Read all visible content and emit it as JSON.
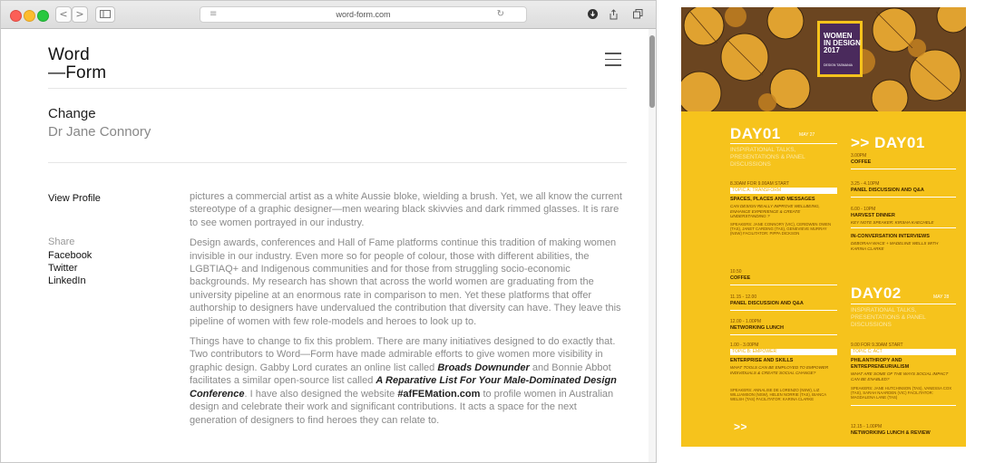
{
  "browser": {
    "reader_icon": "reader-icon",
    "url": "word-form.com",
    "reload_icon": "reload-icon",
    "back": "<",
    "forward": ">"
  },
  "site": {
    "logo_line1": "Word",
    "logo_line2": "—Form",
    "article_title": "Change",
    "article_author": "Dr Jane Connory",
    "view_profile": "View Profile",
    "share_label": "Share",
    "share_links": [
      "Facebook",
      "Twitter",
      "LinkedIn"
    ]
  },
  "article": {
    "p1": "pictures a commercial artist as a white Aussie bloke, wielding a brush. Yet, we all know the current stereotype of a graphic designer—men wearing black skivvies and dark rimmed glasses. It is rare to see women portrayed in our industry.",
    "p2": "Design awards, conferences and Hall of Fame platforms continue this tradition of making women invisible in our industry. Even more so for people of colour, those with different abilities, the LGBTIAQ+ and Indigenous communities and for those from struggling socio-economic backgrounds. My research has shown that across the world women are graduating from the university pipeline at an enormous rate in comparison to men. Yet these platforms that offer authorship to designers have undervalued the contribution that diversity can have. They leave this pipeline of women with few role-models and heroes to look up to.",
    "p3a": "Things have to change to fix this problem. There are many initiatives designed to do exactly that. Two contributors to Word—Form have made admirable efforts to give women more visibility in graphic design. Gabby Lord curates an online list called ",
    "p3b": "Broads Downunder",
    "p3c": " and Bonnie Abbot facilitates a similar open-source list called ",
    "p3d": "A Reparative List For Your Male-Dominated Design Conference",
    "p3e": ". I have also designed the website ",
    "p3f": "#afFEMation.com",
    "p3g": " to profile women in Australian design and celebrate their work and significant contributions. It acts a space for the next generation of designers to find heroes they can relate to."
  },
  "poster": {
    "badge_title": "WOMEN\nIN DESIGN\n2017",
    "badge_sub": "DESIGN TASMANIA",
    "day1_title": "DAY01",
    "day1_date": "MAY 27",
    "day1_sub": "INSPIRATIONAL TALKS, PRESENTATIONS & PANEL DISCUSSIONS",
    "day1_start": "8.30AM FOR 9.00AM START",
    "topic_a": "TOPIC A: TRANSFORM",
    "topic_a_h": "SPACES, PLACES AND MESSAGES",
    "topic_a_q": "CAN DESIGN REALLY IMPROVE WELLBEING, ENHANCE EXPERIENCE & CREATE UNDERSTANDING ?",
    "topic_a_sp": "SPEAKERS: JANE CONNORY (VIC), CERIDWEN OWEN (TAS), JANET CARDING (TAS), GENEVIEVE MURRAY (NSW) FACILITATOR: PIPPA DICKSON",
    "t1050": "10.50",
    "coffee": "COFFEE",
    "t1115": "11.15 - 12.00",
    "panel": "PANEL DISCUSSION AND Q&A",
    "t1200": "12.00 - 1.00PM",
    "lunch": "NETWORKING LUNCH",
    "t100": "1.00 - 3.00PM",
    "topic_b": "TOPIC B: EMPOWER",
    "topic_b_h": "ENTERPRISE AND SKILLS",
    "topic_b_q": "WHAT TOOLS CAN BE EMPLOYED TO EMPOWER INDIVIDUALS & CREATE SOCIAL CHANGE?",
    "topic_b_sp": "SPEAKERS: ANNALISE DE LORENZO (NSW), LIZ WILLIAMSON (NSW), HELEN NORRIE (TAS), BIANCA WELSH (TAS) FACILITATOR: KARINA CLARKE",
    "arrow": ">>",
    "col2_title": ">> DAY01",
    "t300": "3.00PM",
    "t325": "3.25 - 4.10PM",
    "t600": "6.00 - 10PM",
    "harvest": "HARVEST DINNER",
    "keynote": "KEY NOTE SPEAKER: KIRSHA KAECHELE",
    "inconv": "IN-CONVERSATION INTERVIEWS",
    "inconv_sub": "DEBORAH WACE + MADELINE WELLS WITH KARINA CLARKE",
    "day2_title": "DAY02",
    "day2_date": "MAY 28",
    "day2_sub": "INSPIRATIONAL TALKS, PRESENTATIONS & PANEL DISCUSSIONS",
    "day2_start": "9.00 FOR 9.30AM START",
    "topic_c": "TOPIC C: ACT",
    "topic_c_h": "PHILANTHROPY AND ENTREPRENEURIALISM",
    "topic_c_q": "WHAT ARE SOME OF THE WAYS SOCIAL IMPACT CAN BE ENABLED?",
    "topic_c_sp": "SPEAKERS: JANE HUTCHINSON (TAS), VANESSA COX (TAS), SARAH NAARDEN (VIC) FACILITATOR: MAGDALENA LANE (TAS)",
    "t1215": "12.15 - 1.00PM",
    "lunch2": "NETWORKING LUNCH & REVIEW"
  },
  "colors": {
    "accent_yellow": "#f6c31c",
    "badge_purple": "#4a2a5c"
  }
}
